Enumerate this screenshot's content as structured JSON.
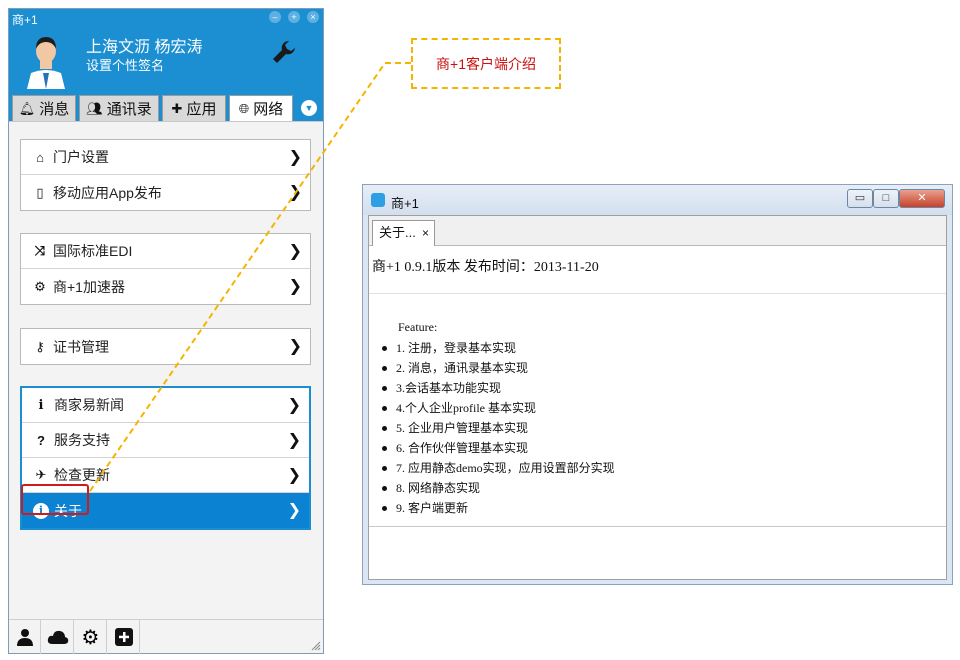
{
  "client": {
    "window_title": "商+1",
    "user_name": "上海文沥 杨宏涛",
    "signature": "设置个性签名",
    "tabs": [
      {
        "label": "消息",
        "icon": "bell-icon"
      },
      {
        "label": "通讯录",
        "icon": "users-icon"
      },
      {
        "label": "应用",
        "icon": "puzzle-icon"
      },
      {
        "label": "网络",
        "icon": "globe-icon",
        "active": true
      }
    ],
    "groups": [
      {
        "items": [
          {
            "label": "门户设置",
            "icon": "home-icon"
          },
          {
            "label": "移动应用App发布",
            "icon": "mobile-icon"
          }
        ]
      },
      {
        "items": [
          {
            "label": "国际标准EDI",
            "icon": "shuffle-icon"
          },
          {
            "label": "商+1加速器",
            "icon": "cogs-icon"
          }
        ]
      },
      {
        "items": [
          {
            "label": "证书管理",
            "icon": "key-icon"
          }
        ]
      },
      {
        "items": [
          {
            "label": "商家易新闻",
            "icon": "info-icon"
          },
          {
            "label": "服务支持",
            "icon": "question-icon"
          },
          {
            "label": "检查更新",
            "icon": "plane-icon"
          },
          {
            "label": "关于",
            "icon": "info-circle-icon",
            "selected": true
          }
        ]
      }
    ],
    "bottom_icons": [
      "user-icon",
      "cloud-icon",
      "gear-icon",
      "plus-square-icon"
    ]
  },
  "callout": {
    "text": "商+1客户端介绍",
    "border_color": "#f4b400",
    "text_color": "#cc1010"
  },
  "about_window": {
    "title": "商+1",
    "tab_label": "关于...",
    "tab_close": "×",
    "version_line": "商+1 0.9.1版本 发布时间：2013-11-20",
    "feature_label": "Feature:",
    "features": [
      "1. 注册，登录基本实现",
      "2. 消息，通讯录基本实现",
      "3.会话基本功能实现",
      "4.个人企业profile 基本实现",
      "5. 企业用户管理基本实现",
      "6. 合作伙伴管理基本实现",
      "7. 应用静态demo实现，应用设置部分实现",
      "8. 网络静态实现",
      "9. 客户端更新"
    ]
  },
  "colors": {
    "client_blue": "#1b8fd2",
    "selected_blue": "#0b82d2",
    "highlight_red": "#d11a1a"
  }
}
